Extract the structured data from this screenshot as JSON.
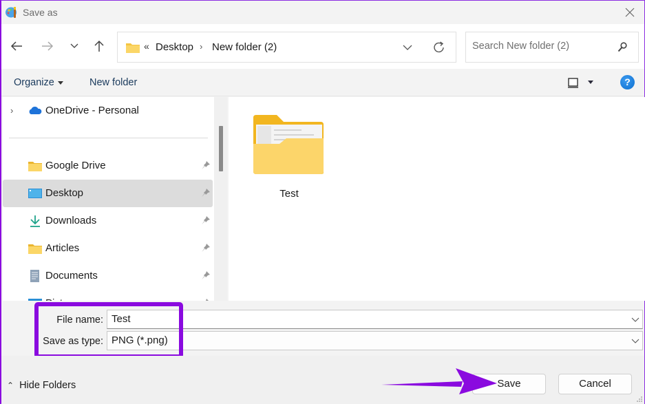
{
  "window": {
    "title": "Save as",
    "app_icon": "paint-palette-icon",
    "close_icon": "close-icon"
  },
  "nav": {
    "back_icon": "arrow-left-icon",
    "forward_icon": "arrow-right-icon",
    "recent_icon": "chevron-down-icon",
    "up_icon": "arrow-up-icon",
    "address": {
      "overflow_glyph": "«",
      "breadcrumbs": [
        "Desktop",
        "New folder (2)"
      ],
      "separator": "›"
    },
    "search": {
      "placeholder": "Search New folder (2)",
      "value": ""
    }
  },
  "commandbar": {
    "organize_label": "Organize",
    "new_folder_label": "New folder",
    "help_label": "?"
  },
  "sidebar": {
    "items": [
      {
        "label": "OneDrive - Personal",
        "icon": "onedrive-cloud-icon",
        "expandable": true,
        "pinned": false
      },
      {
        "label": "Google Drive",
        "icon": "folder-icon",
        "pinned": true
      },
      {
        "label": "Desktop",
        "icon": "desktop-icon",
        "pinned": true,
        "selected": true
      },
      {
        "label": "Downloads",
        "icon": "download-icon",
        "pinned": true
      },
      {
        "label": "Articles",
        "icon": "folder-icon",
        "pinned": true
      },
      {
        "label": "Documents",
        "icon": "documents-icon",
        "pinned": true
      },
      {
        "label": "Pictures",
        "icon": "pictures-icon",
        "pinned": true
      }
    ]
  },
  "content": {
    "items": [
      {
        "name": "Test",
        "type": "folder"
      }
    ]
  },
  "form": {
    "file_name_label": "File name:",
    "file_name_value": "Test",
    "save_type_label": "Save as type:",
    "save_type_value": "PNG (*.png)"
  },
  "footer": {
    "hide_folders_label": "Hide Folders",
    "save_label": "Save",
    "cancel_label": "Cancel"
  },
  "annotation": {
    "highlight_color": "#8a0adf",
    "arrow_color": "#8a0adf"
  }
}
